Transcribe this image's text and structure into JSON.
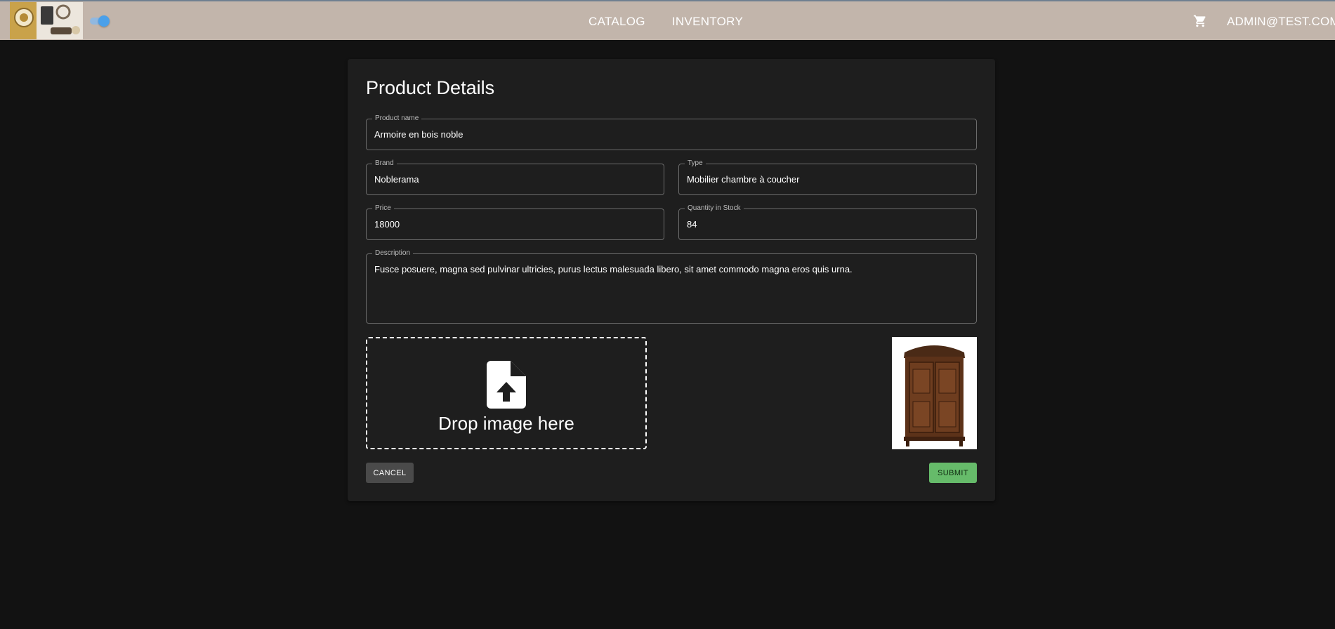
{
  "appbar": {
    "nav": [
      {
        "label": "CATALOG"
      },
      {
        "label": "INVENTORY"
      }
    ],
    "user_label": "ADMIN@TEST.COM",
    "accent_color": "#c2b5ab",
    "toggle_color": "#4aa0ea"
  },
  "form": {
    "title": "Product Details",
    "product_name": {
      "label": "Product name",
      "value": "Armoire en bois noble"
    },
    "brand": {
      "label": "Brand",
      "value": "Noblerama"
    },
    "type": {
      "label": "Type",
      "value": "Mobilier chambre à coucher"
    },
    "price": {
      "label": "Price",
      "value": "18000"
    },
    "quantity": {
      "label": "Quantity in Stock",
      "value": "84"
    },
    "description": {
      "label": "Description",
      "value": "Fusce posuere, magna sed pulvinar ultricies, purus lectus malesuada libero, sit amet commodo magna eros quis urna."
    },
    "dropzone_label": "Drop image here",
    "cancel_label": "CANCEL",
    "submit_label": "SUBMIT",
    "submit_color": "#66bb6a"
  }
}
